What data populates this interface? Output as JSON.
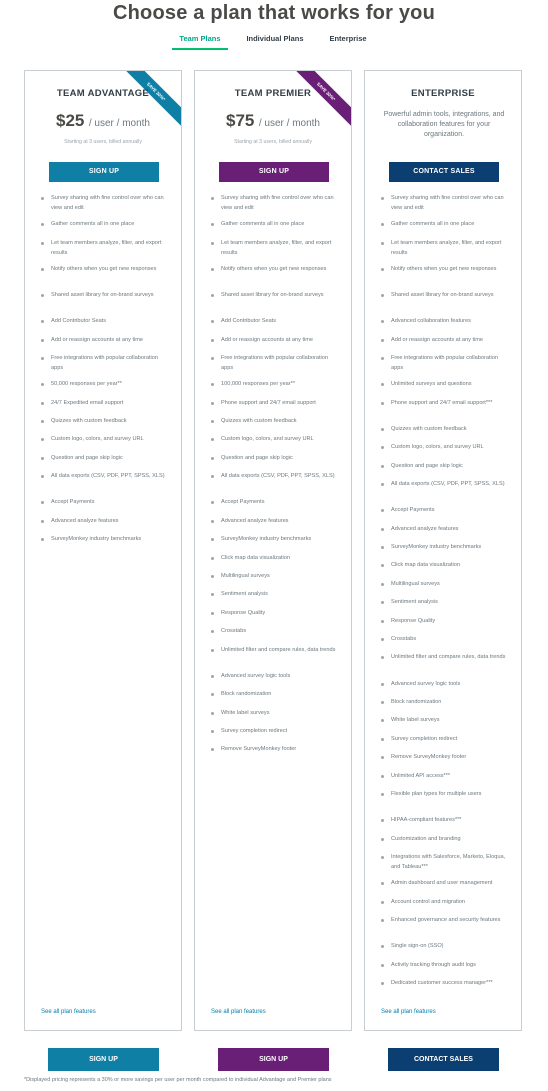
{
  "page_title": "Choose a plan that works for you",
  "tabs": [
    {
      "label": "Team Plans",
      "active": true
    },
    {
      "label": "Individual Plans",
      "active": false
    },
    {
      "label": "Enterprise",
      "active": false
    }
  ],
  "colors": {
    "advantage": "#0f7fa6",
    "premier": "#6a1f77",
    "enterprise": "#0b3f72",
    "accent": "#00bf6f"
  },
  "plans": [
    {
      "name": "TEAM ADVANTAGE",
      "ribbon": "SAVE 30%*",
      "price": "$25",
      "unit": "/ user / month",
      "note": "Starting at 3 users, billed annually",
      "cta": "SIGN UP",
      "see_all": "See all plan features",
      "features": [
        "Survey sharing with fine control over who can view and edit",
        "Gather comments all in one place",
        "Let team members analyze, filter, and export results",
        "Notify others when you get new responses",
        "Shared asset library for on-brand surveys",
        "Add Contributor Seats",
        "Add or reassign accounts at any time",
        "Free integrations with popular collaboration apps",
        "50,000 responses per year**",
        "24/7 Expedited email support",
        "Quizzes with custom feedback",
        "Custom logo, colors, and survey URL",
        "Question and page skip logic",
        "All data exports (CSV, PDF, PPT, SPSS, XLS)",
        "Accept Payments",
        "Advanced analyze features",
        "SurveyMonkey industry benchmarks"
      ]
    },
    {
      "name": "TEAM PREMIER",
      "ribbon": "SAVE 30%*",
      "price": "$75",
      "unit": "/ user / month",
      "note": "Starting at 3 users, billed annually",
      "cta": "SIGN UP",
      "see_all": "See all plan features",
      "features": [
        "Survey sharing with fine control over who can view and edit",
        "Gather comments all in one place",
        "Let team members analyze, filter, and export results",
        "Notify others when you get new responses",
        "Shared asset library for on-brand surveys",
        "Add Contributor Seats",
        "Add or reassign accounts at any time",
        "Free integrations with popular collaboration apps",
        "100,000 responses per year**",
        "Phone support and 24/7 email support",
        "Quizzes with custom feedback",
        "Custom logo, colors, and survey URL",
        "Question and page skip logic",
        "All data exports (CSV, PDF, PPT, SPSS, XLS)",
        "Accept Payments",
        "Advanced analyze features",
        "SurveyMonkey industry benchmarks",
        "Click map data visualization",
        "Multilingual surveys",
        "Sentiment analysis",
        "Response Quality",
        "Crosstabs",
        "Unlimited filter and compare rules, data trends",
        "Advanced survey logic tools",
        "Block randomization",
        "White label surveys",
        "Survey completion redirect",
        "Remove SurveyMonkey footer"
      ]
    },
    {
      "name": "ENTERPRISE",
      "description": "Powerful admin tools, integrations, and collaboration features for your organization.",
      "cta": "CONTACT SALES",
      "see_all": "See all plan features",
      "features": [
        "Survey sharing with fine control over who can view and edit",
        "Gather comments all in one place",
        "Let team members analyze, filter, and export results",
        "Notify others when you get new responses",
        "Shared asset library for on-brand surveys",
        "Advanced collaboration features",
        "Add or reassign accounts at any time",
        "Free integrations with popular collaboration apps",
        "Unlimited surveys and questions",
        "Phone support and 24/7 email support***",
        "Quizzes with custom feedback",
        "Custom logo, colors, and survey URL",
        "Question and page skip logic",
        "All data exports (CSV, PDF, PPT, SPSS, XLS)",
        "Accept Payments",
        "Advanced analyze features",
        "SurveyMonkey industry benchmarks",
        "Click map data visualization",
        "Multilingual surveys",
        "Sentiment analysis",
        "Response Quality",
        "Crosstabs",
        "Unlimited filter and compare rules, data trends",
        "Advanced survey logic tools",
        "Block randomization",
        "White label surveys",
        "Survey completion redirect",
        "Remove SurveyMonkey footer",
        "Unlimited API access***",
        "Flexible plan types for multiple users",
        "HIPAA-compliant features***",
        "Customization and branding",
        "Integrations with Salesforce, Marketo, Eloqua, and Tableau***",
        "Admin dashboard and user management",
        "Account control and migration",
        "Enhanced governance and security features",
        "Single sign-on (SSO)",
        "Activity tracking through audit logs",
        "Dedicated customer success manager***"
      ]
    }
  ],
  "bottom_ctas": [
    "SIGN UP",
    "SIGN UP",
    "CONTACT SALES"
  ],
  "footnote": "*Displayed pricing represents a 30% or more savings per user per month compared to individual Advantage and Premier plans"
}
